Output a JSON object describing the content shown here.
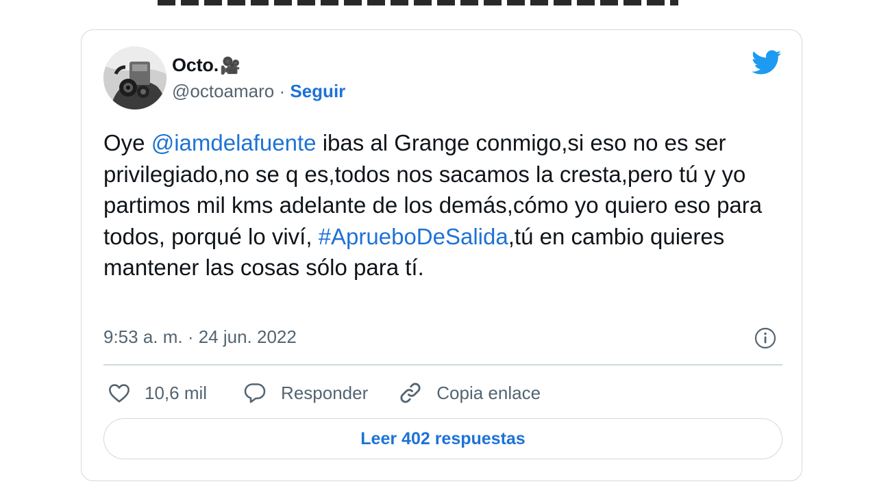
{
  "tweet": {
    "author": {
      "display_name": "Octo.",
      "name_emoji": "🎥",
      "handle": "@octoamaro",
      "separator": "·",
      "follow_label": "Seguir"
    },
    "text": {
      "p1": "Oye ",
      "mention": "@iamdelafuente",
      "p2": " ibas al Grange conmigo,si eso no es ser privilegiado,no se q es,todos nos sacamos la cresta,pero tú y yo partimos mil kms adelante de los demás,cómo yo quiero eso para todos, porqué lo viví, ",
      "hashtag": "#AprueboDeSalida",
      "p3": ",tú en cambio quieres mantener las cosas sólo para tí."
    },
    "timestamp": "9:53 a. m. · 24 jun. 2022",
    "actions": {
      "likes_count": "10,6 mil",
      "reply_label": "Responder",
      "copy_link_label": "Copia enlace"
    },
    "read_replies_label": "Leer 402 respuestas"
  },
  "colors": {
    "link": "#1d72d6",
    "twitter_blue": "#1d9bf0",
    "secondary_text": "#536471",
    "border": "#cfd9de"
  },
  "icons": [
    "twitter-logo-icon",
    "info-icon",
    "heart-icon",
    "reply-bubble-icon",
    "link-icon",
    "movie-camera-emoji"
  ]
}
